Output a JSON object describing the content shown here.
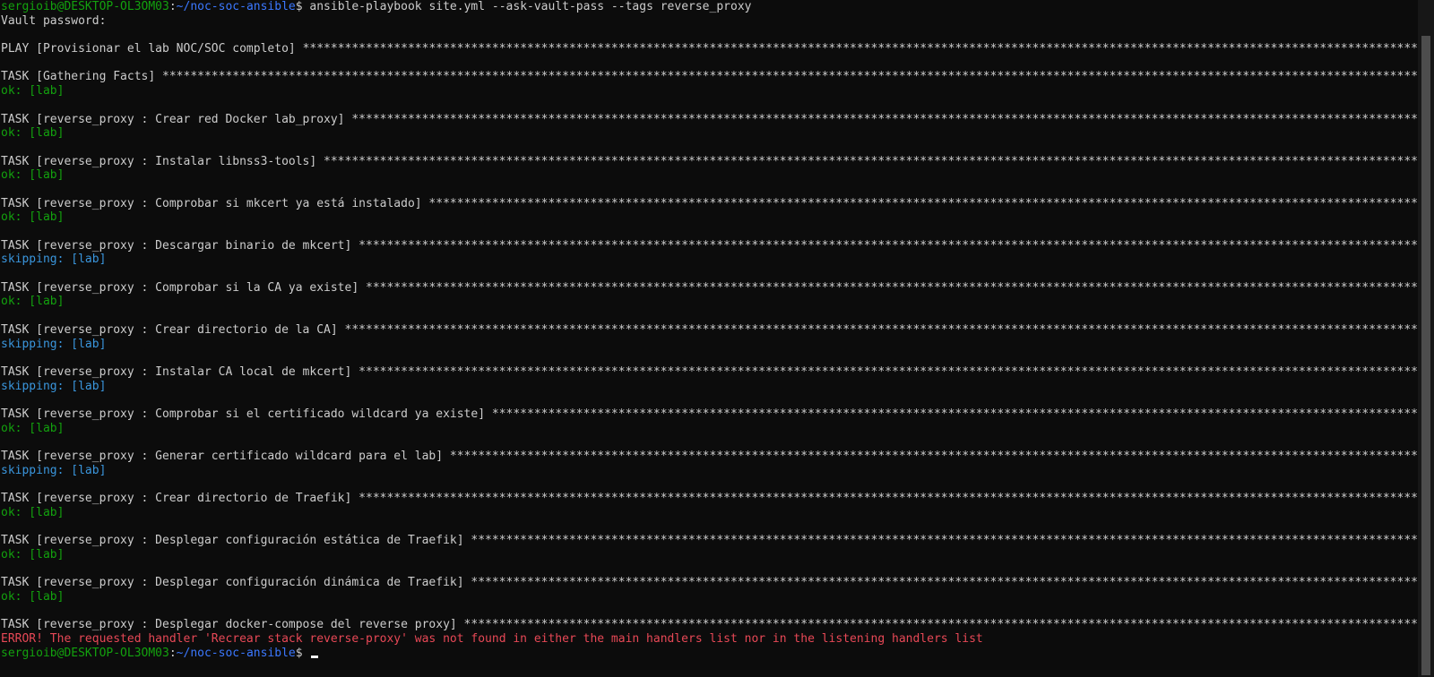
{
  "prompt": {
    "user_host": "sergioib@DESKTOP-OL3OM03",
    "path": "~/noc-soc-ansible",
    "symbol": "$ "
  },
  "command": "ansible-playbook site.yml --ask-vault-pass --tags reverse_proxy",
  "vault_prompt": "Vault password:",
  "play_line": "PLAY [Provisionar el lab NOC/SOC completo]",
  "tasks": [
    {
      "title": "TASK [Gathering Facts]",
      "result": "ok: [lab]"
    },
    {
      "title": "TASK [reverse_proxy : Crear red Docker lab_proxy]",
      "result": "ok: [lab]"
    },
    {
      "title": "TASK [reverse_proxy : Instalar libnss3-tools]",
      "result": "ok: [lab]"
    },
    {
      "title": "TASK [reverse_proxy : Comprobar si mkcert ya está instalado]",
      "result": "ok: [lab]"
    },
    {
      "title": "TASK [reverse_proxy : Descargar binario de mkcert]",
      "result": "skipping: [lab]"
    },
    {
      "title": "TASK [reverse_proxy : Comprobar si la CA ya existe]",
      "result": "ok: [lab]"
    },
    {
      "title": "TASK [reverse_proxy : Crear directorio de la CA]",
      "result": "skipping: [lab]"
    },
    {
      "title": "TASK [reverse_proxy : Instalar CA local de mkcert]",
      "result": "skipping: [lab]"
    },
    {
      "title": "TASK [reverse_proxy : Comprobar si el certificado wildcard ya existe]",
      "result": "ok: [lab]"
    },
    {
      "title": "TASK [reverse_proxy : Generar certificado wildcard para el lab]",
      "result": "skipping: [lab]"
    },
    {
      "title": "TASK [reverse_proxy : Crear directorio de Traefik]",
      "result": "ok: [lab]"
    },
    {
      "title": "TASK [reverse_proxy : Desplegar configuración estática de Traefik]",
      "result": "ok: [lab]"
    },
    {
      "title": "TASK [reverse_proxy : Desplegar configuración dinámica de Traefik]",
      "result": "ok: [lab]"
    },
    {
      "title": "TASK [reverse_proxy : Desplegar docker-compose del reverse proxy]",
      "result": ""
    }
  ],
  "error": "ERROR! The requested handler 'Recrear stack reverse-proxy' was not found in either the main handlers list nor in the listening handlers list",
  "colors": {
    "background": "#0c0c0c",
    "text": "#cccccc",
    "green": "#13a10e",
    "blue": "#3b78ff",
    "skip": "#3a96dd",
    "red": "#e74856"
  }
}
